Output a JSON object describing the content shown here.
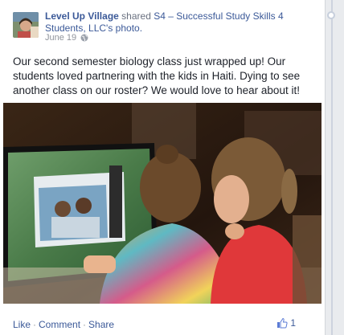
{
  "post": {
    "page_name": "Level Up Village",
    "shared_word": "shared",
    "shared_target": "S4 – Successful Study Skills 4 Students, LLC's photo.",
    "date": "June 19",
    "privacy_icon": "globe-icon",
    "message": "Our second semester biology class just wrapped up! Our students loved partnering with the kids in Haiti. Dying to see another class on our roster? We would love to hear about it!"
  },
  "actions": {
    "like": "Like",
    "comment": "Comment",
    "share": "Share",
    "separator": "·"
  },
  "likes": {
    "icon": "thumbs-up-icon",
    "count": "1"
  },
  "colors": {
    "link": "#3b5998",
    "muted": "#90949c",
    "text": "#1d2129"
  }
}
